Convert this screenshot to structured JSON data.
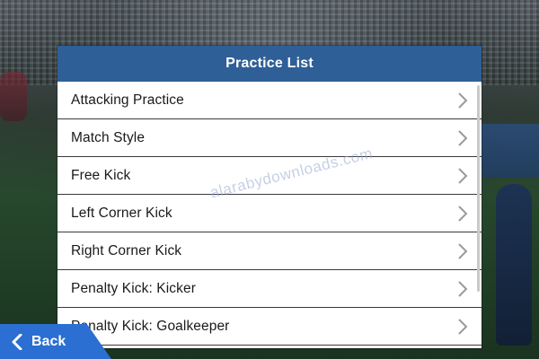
{
  "panel": {
    "title": "Practice List",
    "items": [
      {
        "label": "Attacking Practice"
      },
      {
        "label": "Match Style"
      },
      {
        "label": "Free Kick"
      },
      {
        "label": "Left Corner Kick"
      },
      {
        "label": "Right Corner Kick"
      },
      {
        "label": "Penalty Kick: Kicker"
      },
      {
        "label": "Penalty Kick: Goalkeeper"
      }
    ]
  },
  "back_button": {
    "label": "Back",
    "icon": "chevron-left-icon"
  },
  "watermark": {
    "text": "alarabydownloads.com"
  },
  "colors": {
    "header": "#2f5f97",
    "back_button": "#2a6fd1",
    "row_text": "#1a1a1a",
    "chevron": "#9a9a9a"
  }
}
